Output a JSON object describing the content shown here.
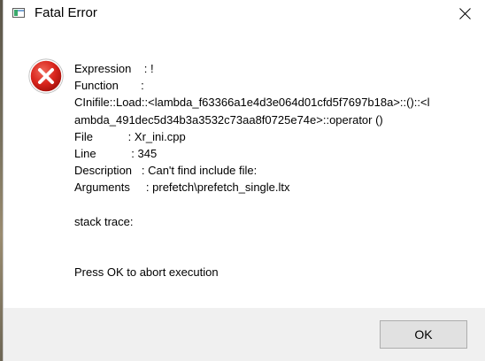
{
  "window": {
    "title": "Fatal Error",
    "icon": "app-icon",
    "close_icon": "close-icon"
  },
  "message": {
    "icon": "error-icon",
    "expression": "Expression    : !",
    "function_label": "Function       :",
    "function_value_1": "CInifile::Load::<lambda_f63366a1e4d3e064d01cfd5f7697b18a>::()::<l",
    "function_value_2": "ambda_491dec5d34b3a3532c73aa8f0725e74e>::operator ()",
    "file": "File           : Xr_ini.cpp",
    "line": "Line           : 345",
    "description": "Description   : Can't find include file:",
    "arguments": "Arguments     : prefetch\\prefetch_single.ltx",
    "stack_trace": "stack trace:",
    "instruction": "Press OK to abort execution"
  },
  "buttons": {
    "ok_label": "OK"
  },
  "colors": {
    "error_red": "#d9251d",
    "footer_bg": "#f0f0f0",
    "button_bg": "#e1e1e1"
  }
}
